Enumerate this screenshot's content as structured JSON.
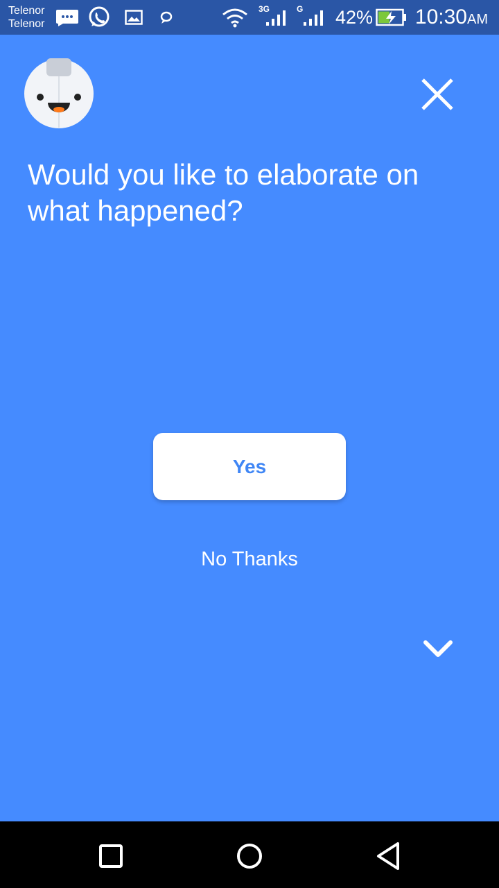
{
  "status_bar": {
    "carrier_1": "Telenor",
    "carrier_2": "Telenor",
    "network_1": "3G",
    "network_2": "G",
    "battery": "42%",
    "time": "10:30",
    "time_suffix": "AM"
  },
  "dialog": {
    "question": "Would you like to elaborate on what happened?",
    "yes_label": "Yes",
    "no_label": "No Thanks"
  },
  "colors": {
    "background": "#458bff",
    "status_bar": "#2a56a6",
    "accent_text": "#3f86f5"
  },
  "icons": {
    "avatar": "robot-avatar-icon",
    "close": "close-icon",
    "expand": "chevron-down-icon",
    "nav": [
      "recents-square-icon",
      "home-circle-icon",
      "back-triangle-icon"
    ]
  }
}
